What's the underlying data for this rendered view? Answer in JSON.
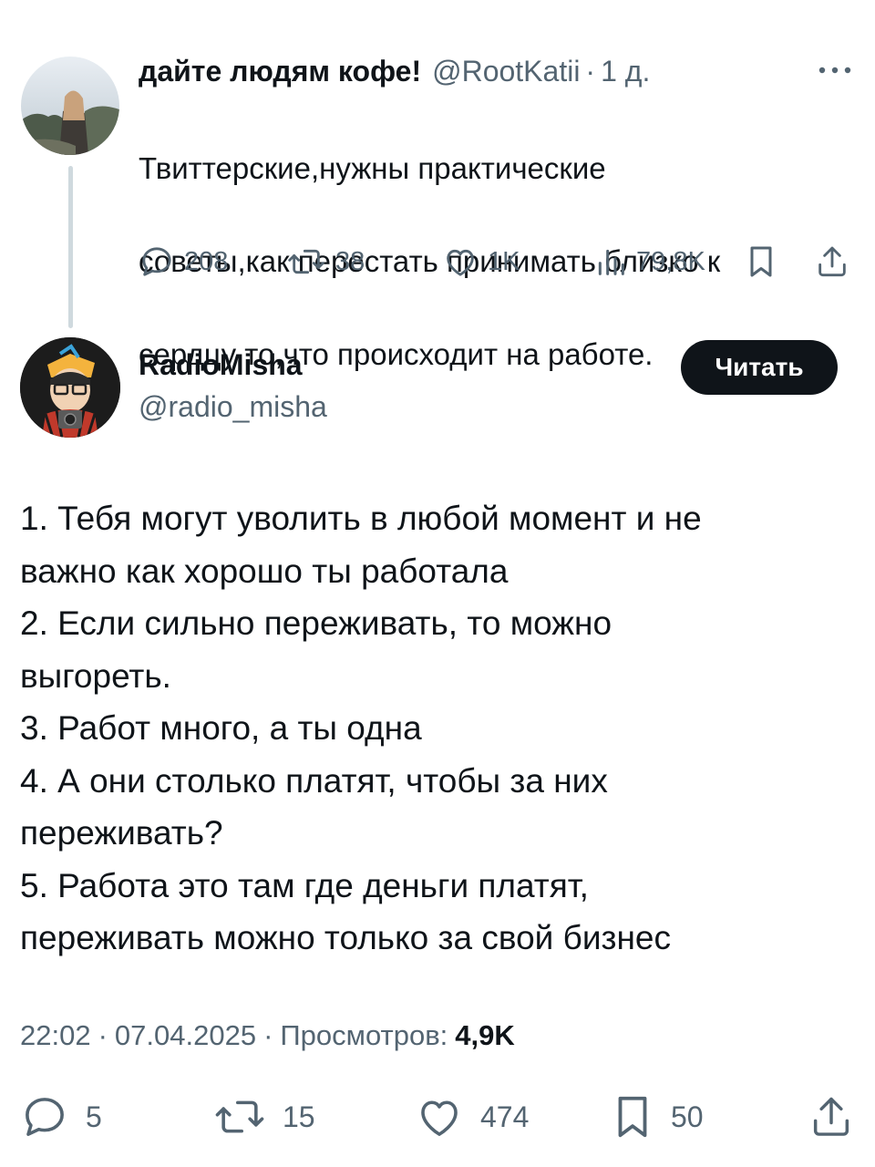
{
  "parent_tweet": {
    "author_name": "дайте людям кофе!",
    "handle": "@RootKatii",
    "separator": "·",
    "time": "1 д.",
    "more_icon": "more-horizontal-icon",
    "text_lines": [
      "Твиттерские,нужны практические",
      "советы,как перестать принимать близко к",
      "сердцу то,что происходит на работе."
    ],
    "actions": {
      "replies": "208",
      "retweets": "38",
      "likes": "1K",
      "views": "79,8K"
    }
  },
  "main_tweet": {
    "author_name": "RadioMisha",
    "handle": "@radio_misha",
    "follow_label": "Читать",
    "text_lines": [
      "1. Тебя могут уволить в любой момент и не",
      "важно как хорошо ты работала",
      "2. Если сильно переживать, то можно",
      "выгореть.",
      "3. Работ много, а ты одна",
      "4. А они столько платят, чтобы за них",
      "переживать?",
      "5. Работа это там где деньги платят,",
      "переживать можно только за свой бизнес"
    ],
    "time": "22:02",
    "date": "07.04.2025",
    "separator": "·",
    "views_label": "Просмотров:",
    "views_count": "4,9K",
    "actions": {
      "replies": "5",
      "retweets": "15",
      "likes": "474",
      "bookmarks": "50"
    }
  },
  "colors": {
    "text": "#0f1419",
    "secondary": "#536471",
    "thread_line": "#cfd9de",
    "button_bg": "#0f1419"
  },
  "icons": [
    "reply-icon",
    "retweet-icon",
    "like-icon",
    "views-icon",
    "bookmark-icon",
    "share-icon"
  ]
}
